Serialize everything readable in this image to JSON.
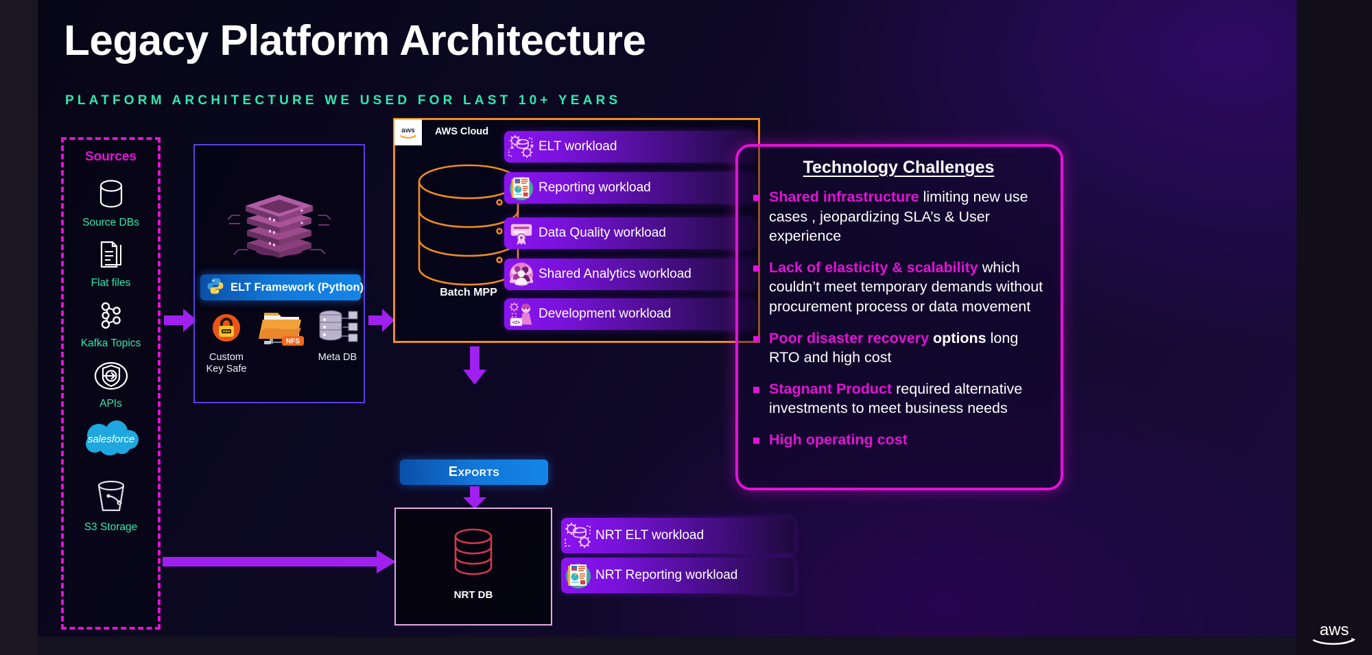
{
  "header": {
    "title": "Legacy Platform Architecture",
    "subtitle": "PLATFORM ARCHITECTURE WE USED FOR LAST 10+ YEARS",
    "accent_teal": "#2fe8b0",
    "accent_magenta": "#e312d6"
  },
  "sources_panel": {
    "heading": "Sources",
    "items": [
      {
        "label": "Source DBs",
        "icon": "database-cylinder-icon"
      },
      {
        "label": "Flat files",
        "icon": "documents-icon"
      },
      {
        "label": "Kafka Topics",
        "icon": "kafka-nodes-icon"
      },
      {
        "label": "APIs",
        "icon": "api-shield-icon"
      },
      {
        "label": "salesforce",
        "icon": "salesforce-cloud-icon"
      },
      {
        "label": "S3 Storage",
        "icon": "s3-bucket-icon"
      }
    ]
  },
  "elt_panel": {
    "server_icon": "server-stack-icon",
    "framework_banner": {
      "label": "ELT Framework  (Python)",
      "icon": "python-logo-icon"
    },
    "components": [
      {
        "label": "Custom\nKey Safe",
        "icon": "padlock-icon"
      },
      {
        "label": "",
        "icon": "nfs-folder-icon",
        "badge": "NFS"
      },
      {
        "label": "Meta DB",
        "icon": "meta-db-icon"
      }
    ]
  },
  "aws_cloud": {
    "logo_label": "aws",
    "title": "AWS Cloud",
    "database_label": "Batch MPP",
    "border_color": "#ef8c1f",
    "workloads": [
      {
        "label": "ELT workload",
        "icon": "gears-database-icon"
      },
      {
        "label": "Reporting workload",
        "icon": "report-charts-icon"
      },
      {
        "label": "Data Quality workload",
        "icon": "quality-badge-icon"
      },
      {
        "label": "Shared Analytics workload",
        "icon": "people-group-icon"
      },
      {
        "label": "Development workload",
        "icon": "developer-code-icon"
      }
    ]
  },
  "exports": {
    "label": "Exports"
  },
  "nrt": {
    "db_label": "NRT DB",
    "workloads": [
      {
        "label": "NRT ELT workload",
        "icon": "gears-database-icon"
      },
      {
        "label": "NRT Reporting workload",
        "icon": "report-charts-icon"
      }
    ]
  },
  "challenges": {
    "title": "Technology Challenges",
    "items": [
      {
        "highlight": "Shared infrastructure",
        "bold_tail": "",
        "rest": " limiting new use cases , jeopardizing SLA’s & User experience"
      },
      {
        "highlight": "Lack of elasticity & scalability",
        "bold_tail": "",
        "rest": " which couldn’t meet temporary demands without procurement process or data movement"
      },
      {
        "highlight": "Poor disaster recovery",
        "bold_tail": " options",
        "rest": " long RTO and high cost"
      },
      {
        "highlight": "Stagnant Product",
        "bold_tail": "",
        "rest": " required alternative investments to meet business needs"
      },
      {
        "highlight": "High operating cost",
        "bold_tail": "",
        "rest": ""
      }
    ]
  },
  "footer": {
    "aws_logo": "aws-logo-icon"
  }
}
